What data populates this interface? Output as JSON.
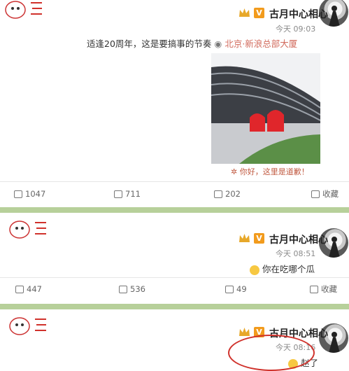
{
  "posts": [
    {
      "username": "古月中心相心",
      "time": "今天 09:03",
      "content": "适逢20周年，这是要搞事的节奏",
      "location": "北京·新浪总部大厦",
      "image_caption": "你好，这里是道歉！",
      "actions": {
        "like": "1047",
        "comment": "711",
        "share": "202",
        "fav": "收藏"
      }
    },
    {
      "username": "古月中心相心",
      "time": "今天 08:51",
      "content": "你在吃哪个瓜",
      "actions": {
        "like": "447",
        "comment": "536",
        "share": "49",
        "fav": "收藏"
      }
    },
    {
      "username": "古月中心相心",
      "time": "今天 08:16",
      "content": "赵了"
    }
  ],
  "colors": {
    "divider": "#b7d09a",
    "accent": "#f29b1d",
    "annotation": "#d0322c"
  }
}
